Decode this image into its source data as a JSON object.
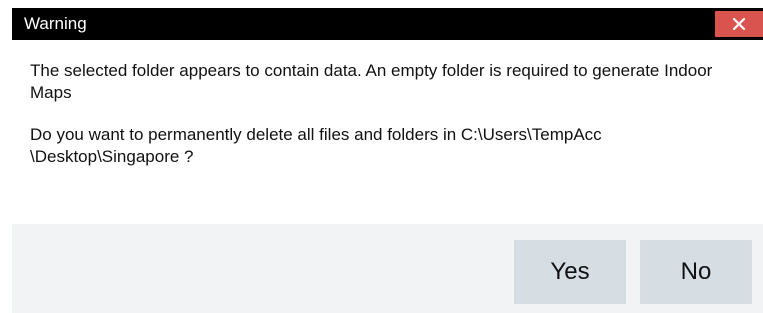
{
  "window": {
    "title": "Warning",
    "close_icon": "close-icon"
  },
  "message": {
    "line1": "The selected folder appears to contain data. An empty folder is required to generate Indoor Maps",
    "line2": "Do you want to permanently delete all files and folders in C:\\Users\\TempAcc \\Desktop\\Singapore ?"
  },
  "buttons": {
    "yes_label": "Yes",
    "no_label": "No"
  },
  "colors": {
    "titlebar_bg": "#000000",
    "close_bg": "#d9534f",
    "footer_bg": "#f1f3f5",
    "button_bg": "#d6dde3"
  }
}
